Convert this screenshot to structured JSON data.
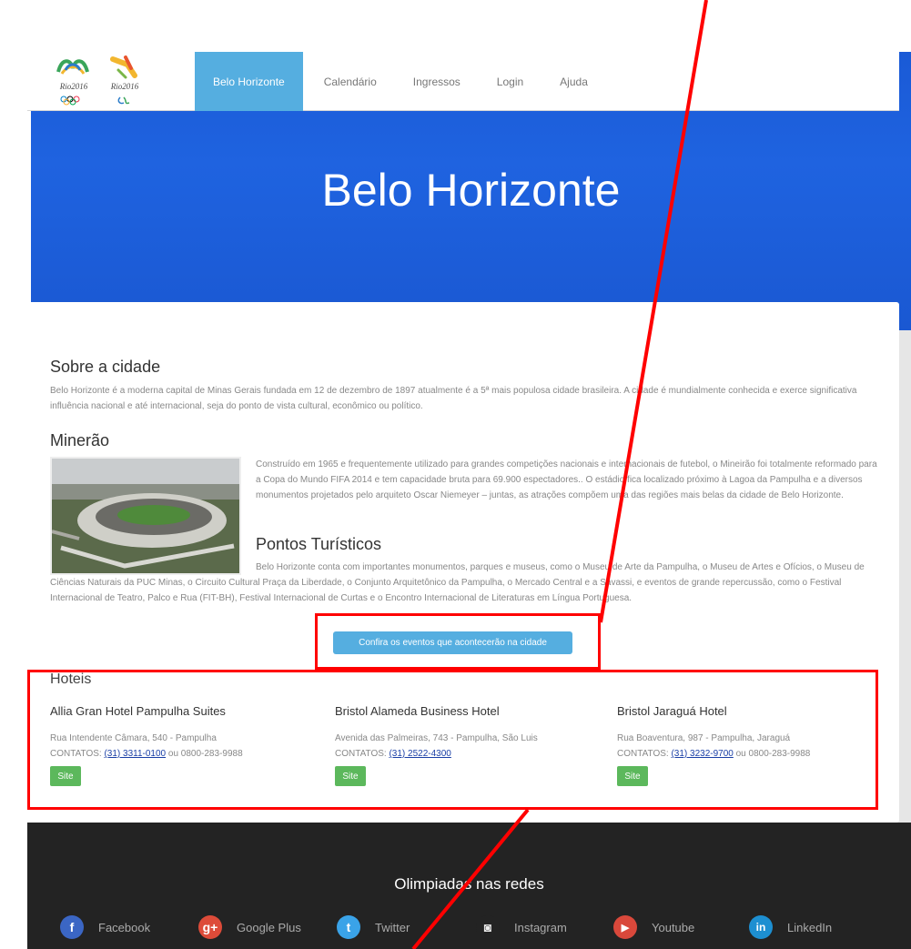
{
  "nav": {
    "logo_olympic": "Rio2016",
    "logo_para": "Rio2016",
    "items": [
      {
        "label": "Belo Horizonte",
        "active": true
      },
      {
        "label": "Calendário"
      },
      {
        "label": "Ingressos"
      },
      {
        "label": "Login"
      },
      {
        "label": "Ajuda"
      }
    ]
  },
  "hero": {
    "title": "Belo Horizonte"
  },
  "about": {
    "title": "Sobre a cidade",
    "text": "Belo Horizonte é a moderna capital de Minas Gerais fundada em 12 de dezembro de 1897 atualmente é a 5ª mais populosa cidade brasileira. A cidade é mundialmente conhecida e exerce significativa influência nacional e até internacional, seja do ponto de vista cultural, econômico ou político."
  },
  "mineirao": {
    "title": "Minerão",
    "text": "Construído em 1965 e frequentemente utilizado para grandes competições nacionais e internacionais de futebol, o Mineirão foi totalmente reformado para a Copa do Mundo FIFA 2014 e tem capacidade bruta para 69.900 espectadores.. O estádio fica localizado próximo à Lagoa da Pampulha e a diversos monumentos projetados pelo arquiteto Oscar Niemeyer – juntas, as atrações compõem uma das regiões mais belas da cidade de Belo Horizonte."
  },
  "pontos": {
    "title": "Pontos Turísticos",
    "text": "Belo Horizonte conta com importantes monumentos, parques e museus, como o Museu de Arte da Pampulha, o Museu de Artes e Ofícios, o Museu de Ciências Naturais da PUC Minas, o Circuito Cultural Praça da Liberdade, o Conjunto Arquitetônico da Pampulha, o Mercado Central e a Savassi, e eventos de grande repercussão, como o Festival Internacional de Teatro, Palco e Rua (FIT-BH), Festival Internacional de Curtas e o Encontro Internacional de Literaturas em Língua Portuguesa."
  },
  "events_button": "Confira os eventos que acontecerão na cidade",
  "hotels": {
    "title": "Hoteis",
    "contacts_label": "CONTATOS:",
    "site_label": "Site",
    "items": [
      {
        "name": "Allia Gran Hotel Pampulha Suites",
        "address": "Rua Intendente Câmara, 540 - Pampulha",
        "phone": "(31) 3311-0100",
        "extra": " ou 0800-283-9988"
      },
      {
        "name": "Bristol Alameda Business Hotel",
        "address": "Avenida das Palmeiras, 743 - Pampulha, São Luis",
        "phone": "(31) 2522-4300",
        "extra": ""
      },
      {
        "name": "Bristol Jaraguá Hotel",
        "address": "Rua Boaventura, 987 - Pampulha, Jaraguá",
        "phone": "(31) 3232-9700",
        "extra": " ou 0800-283-9988"
      }
    ]
  },
  "footer": {
    "title": "Olimpiadas nas redes",
    "social": [
      {
        "label": "Facebook",
        "icon": "facebook-icon",
        "glyph": "f",
        "color": "#3b66c4"
      },
      {
        "label": "Google Plus",
        "icon": "google-plus-icon",
        "glyph": "g+",
        "color": "#dd4b39"
      },
      {
        "label": "Twitter",
        "icon": "twitter-icon",
        "glyph": "t",
        "color": "#3aa3e8"
      },
      {
        "label": "Instagram",
        "icon": "instagram-icon",
        "glyph": "◙",
        "color": "#232323"
      },
      {
        "label": "Youtube",
        "icon": "youtube-icon",
        "glyph": "▶",
        "color": "#d9483b"
      },
      {
        "label": "LinkedIn",
        "icon": "linkedin-icon",
        "glyph": "in",
        "color": "#1d8fd1"
      }
    ]
  },
  "colors": {
    "nav_active": "#55aee0",
    "hero": "#1f63e0",
    "site_button": "#5cb85c",
    "annotation": "#ff0000",
    "footer": "#232323"
  }
}
